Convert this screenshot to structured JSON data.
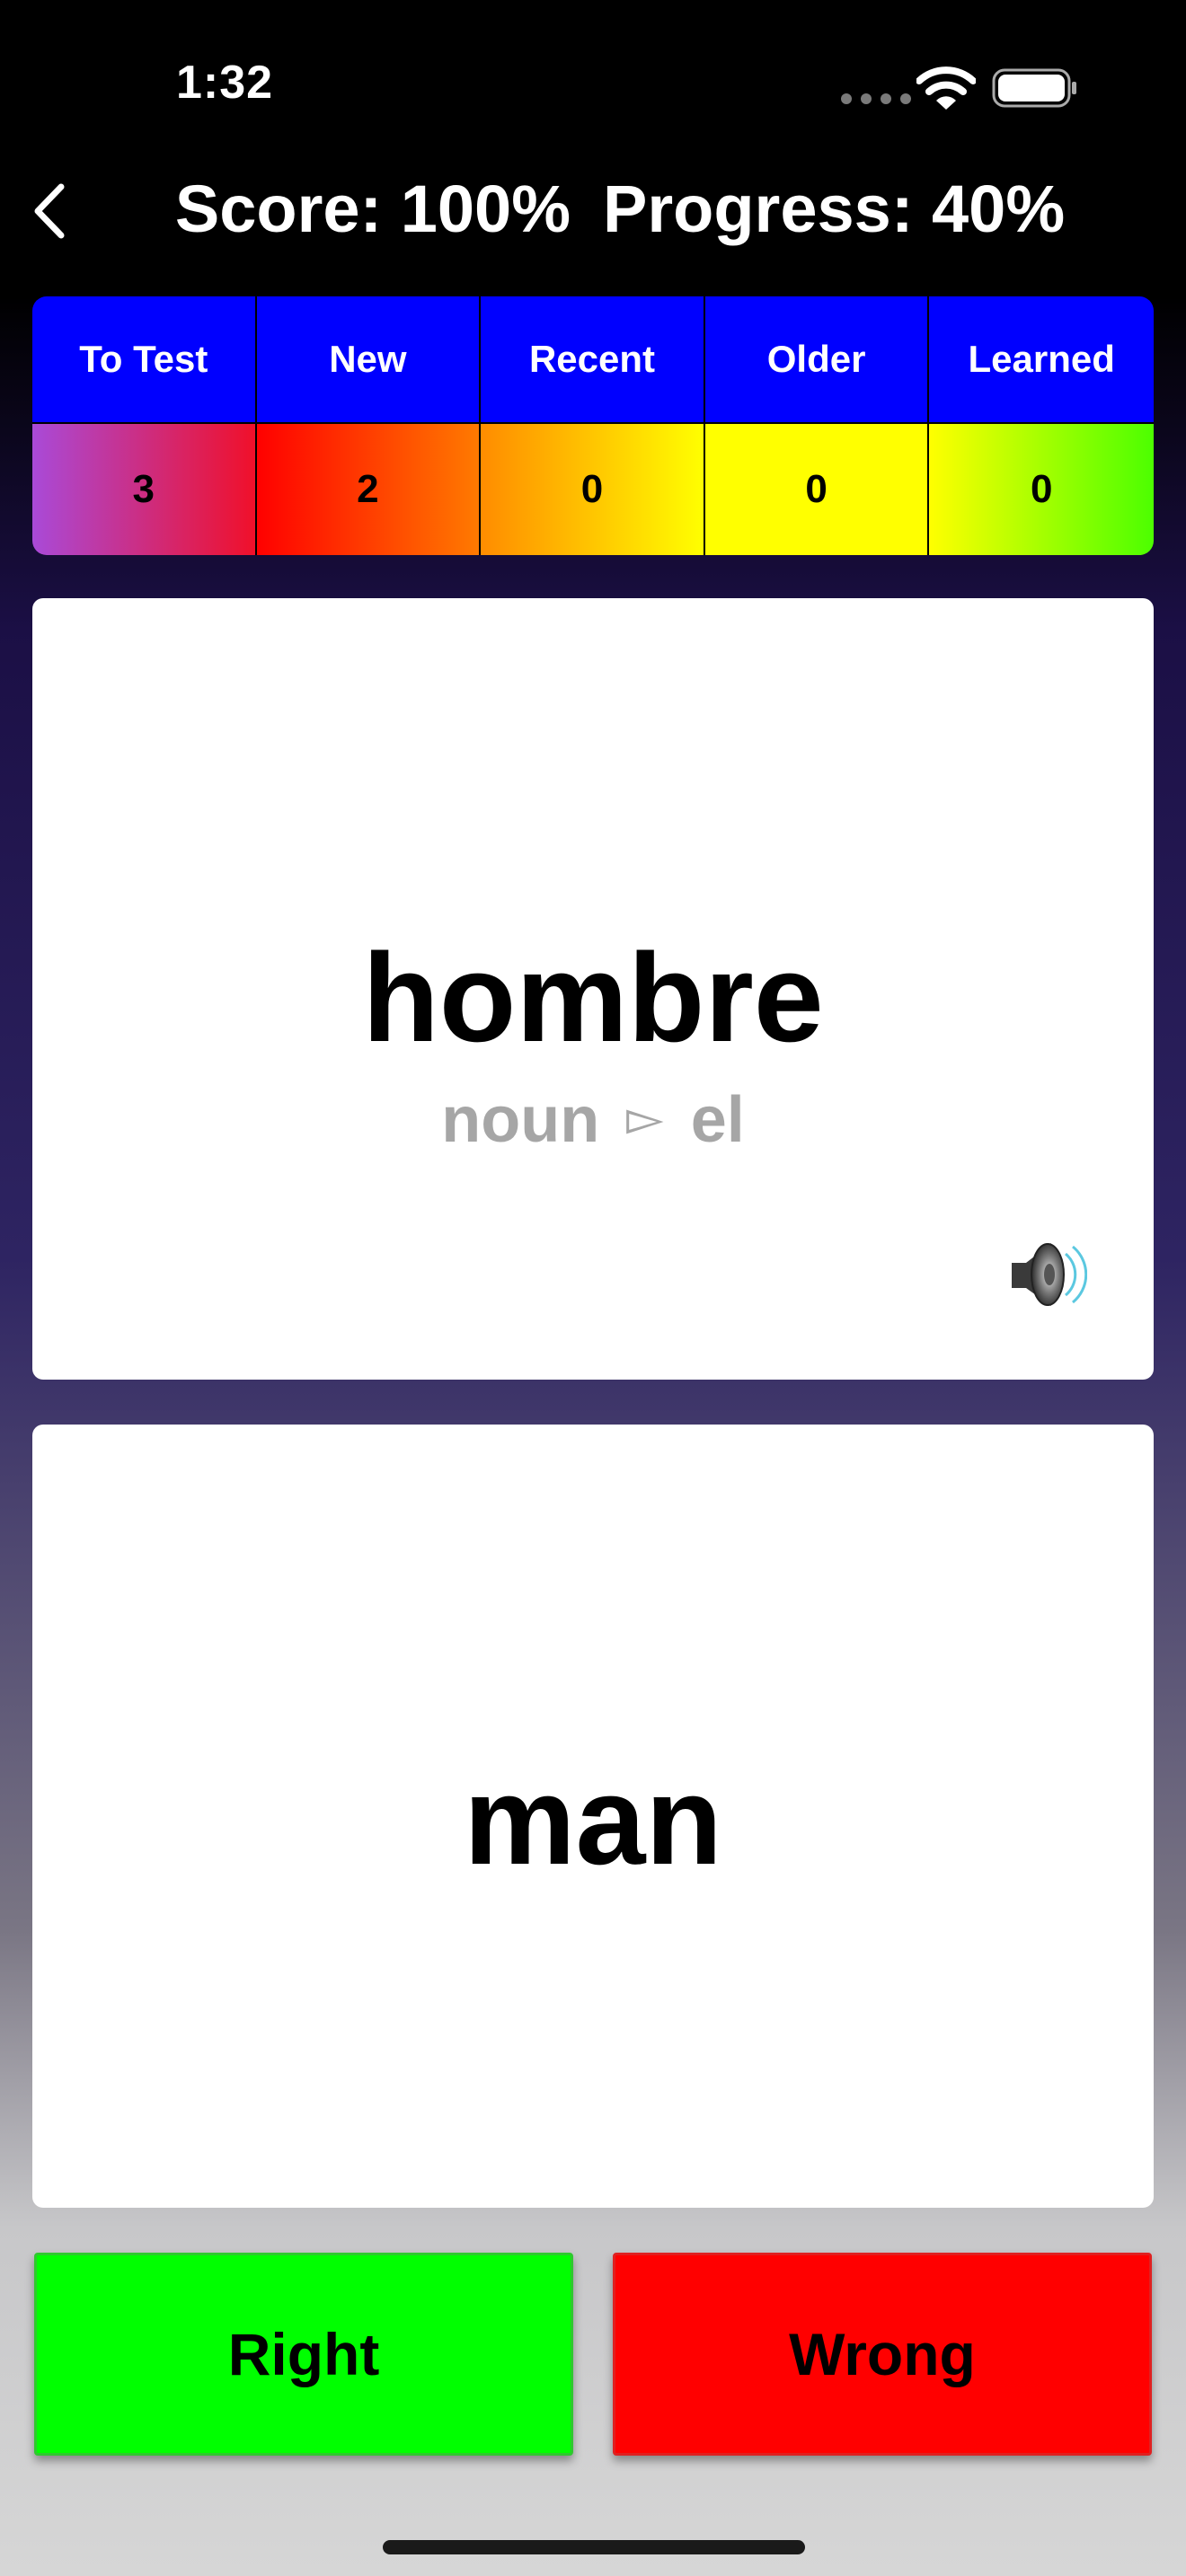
{
  "status_bar": {
    "time": "1:32"
  },
  "header": {
    "score": "Score: 100%",
    "progress": "Progress: 40%"
  },
  "stats": {
    "columns": [
      {
        "label": "To Test",
        "value": "3"
      },
      {
        "label": "New",
        "value": "2"
      },
      {
        "label": "Recent",
        "value": "0"
      },
      {
        "label": "Older",
        "value": "0"
      },
      {
        "label": "Learned",
        "value": "0"
      }
    ]
  },
  "front_card": {
    "word": "hombre",
    "part_of_speech": "noun",
    "separator": "▻",
    "article": "el"
  },
  "back_card": {
    "translation": "man"
  },
  "buttons": {
    "right": "Right",
    "wrong": "Wrong"
  },
  "colors": {
    "header_blue": "#0000ff",
    "right_green": "#00ff00",
    "wrong_red": "#ff0000"
  },
  "icons": [
    "back-chevron-icon",
    "wifi-icon",
    "battery-icon",
    "speaker-icon"
  ]
}
